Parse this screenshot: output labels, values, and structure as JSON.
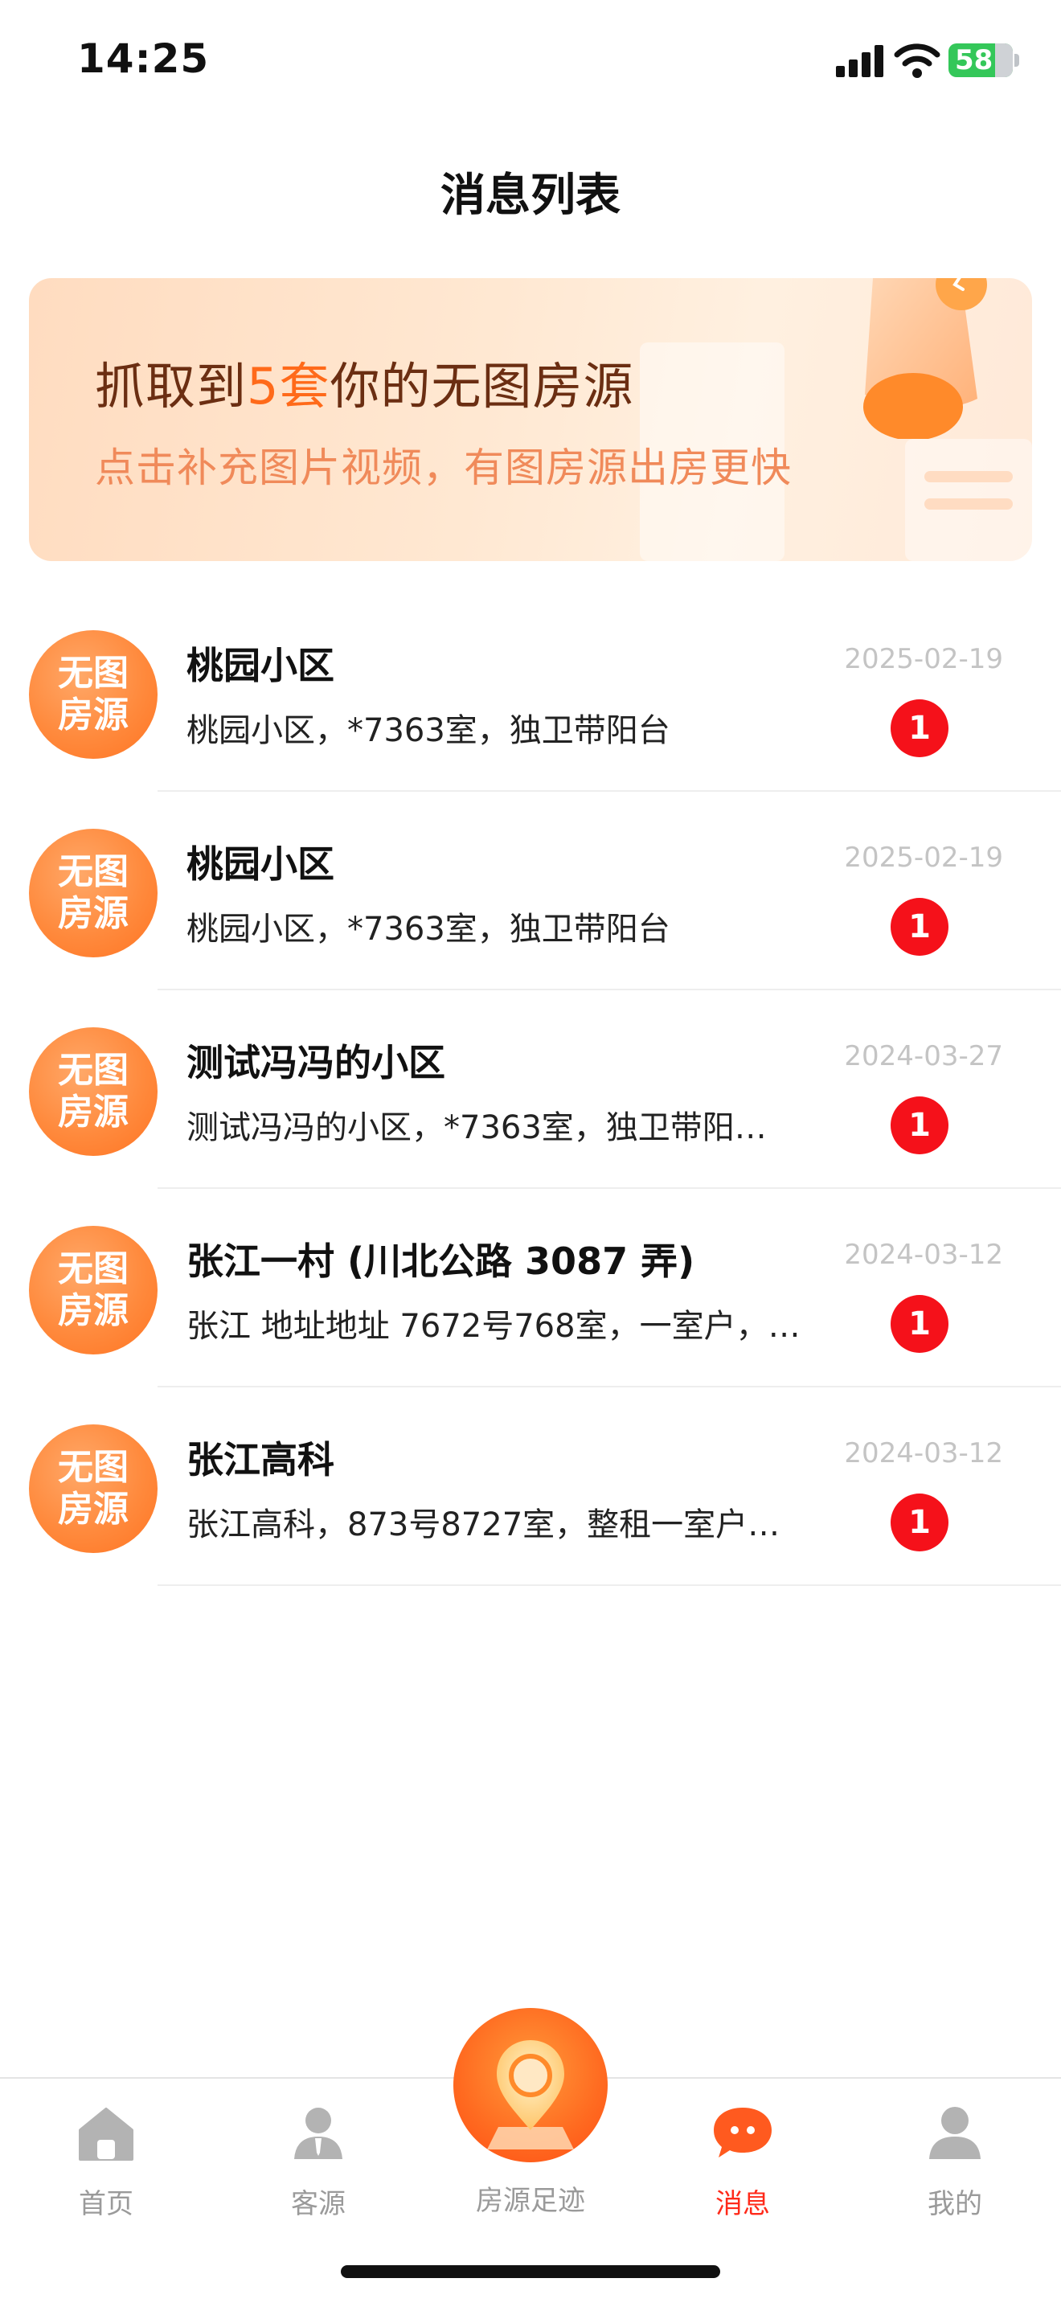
{
  "status_bar": {
    "time": "14:25",
    "battery": "58"
  },
  "header": {
    "title": "消息列表"
  },
  "banner": {
    "title_prefix": "抓取到",
    "title_count": "5套",
    "title_suffix": "你的无图房源",
    "subtitle": "点击补充图片视频，有图房源出房更快"
  },
  "messages": [
    {
      "avatar_text": "无图房源",
      "title": "桃园小区",
      "desc": "桃园小区，*7363室，独卫带阳台",
      "date": "2025-02-19",
      "badge": "1"
    },
    {
      "avatar_text": "无图房源",
      "title": "桃园小区",
      "desc": "桃园小区，*7363室，独卫带阳台",
      "date": "2025-02-19",
      "badge": "1"
    },
    {
      "avatar_text": "无图房源",
      "title": "测试冯冯的小区",
      "desc": "测试冯冯的小区，*7363室，独卫带阳…",
      "date": "2024-03-27",
      "badge": "1"
    },
    {
      "avatar_text": "无图房源",
      "title": "张江一村 (川北公路 3087 弄)",
      "desc": "张江 地址地址 7672号768室，一室户，…",
      "date": "2024-03-12",
      "badge": "1"
    },
    {
      "avatar_text": "无图房源",
      "title": "张江高科",
      "desc": "张江高科，873号8727室，整租一室户…",
      "date": "2024-03-12",
      "badge": "1"
    }
  ],
  "tabs": [
    {
      "label": "首页",
      "icon": "home-icon"
    },
    {
      "label": "客源",
      "icon": "client-icon"
    },
    {
      "label": "房源足迹",
      "icon": "map-pin-icon"
    },
    {
      "label": "消息",
      "icon": "chat-bubble-icon"
    },
    {
      "label": "我的",
      "icon": "profile-icon"
    }
  ],
  "colors": {
    "accent": "#ff6a1a",
    "active_tab": "#ff2a1a",
    "badge": "#f5111a"
  }
}
